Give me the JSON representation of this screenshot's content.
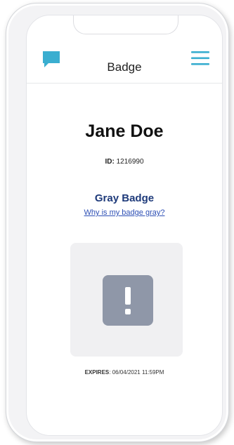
{
  "header": {
    "title": "Badge",
    "chat_icon": "chat-bubble-icon",
    "menu_icon": "hamburger-menu-icon",
    "accent_color": "#3aaed0"
  },
  "user": {
    "name": "Jane Doe",
    "id_label": "ID:",
    "id_value": "1216990"
  },
  "badge": {
    "status": "Gray Badge",
    "help_link": "Why is my badge gray?",
    "icon": "exclamation-icon",
    "color": "#8f97a8",
    "expires_label": "EXPIRES",
    "expires_value": ": 06/04/2021 11:59PM"
  }
}
